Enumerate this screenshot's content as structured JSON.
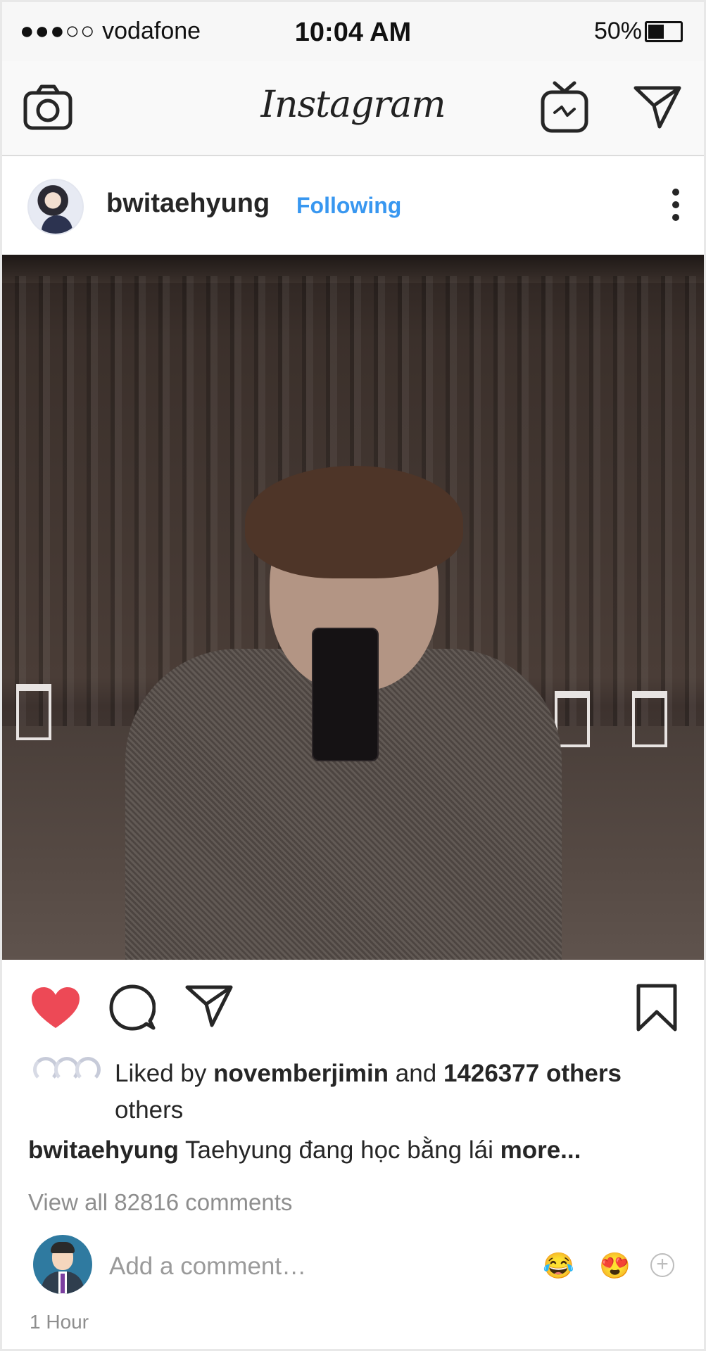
{
  "status_bar": {
    "signal_dots": "●●●○○",
    "carrier": "vodafone",
    "time": "10:04 AM",
    "battery_percent": "50%",
    "battery_level": 0.5
  },
  "nav": {
    "brand": "Instagram",
    "left_icon": "camera-icon",
    "igtv_icon": "igtv-icon",
    "direct_icon": "direct-message-icon"
  },
  "post": {
    "username": "bwitaehyung",
    "follow_status": "Following",
    "photo_alt": "post-photo",
    "liked": true,
    "likes": {
      "prefix": "Liked by",
      "liker": "novemberjimin",
      "and": "and",
      "count": "1426377",
      "others_bold": "others",
      "others": "others"
    },
    "caption": {
      "username": "bwitaehyung",
      "text": "Taehyung đang học bằng lái",
      "more": "more..."
    },
    "view_comments": "View all 82816 comments",
    "add_comment_placeholder": "Add a comment…",
    "quick_emojis": [
      "😂",
      "😍"
    ],
    "time_ago": "1 Hour"
  },
  "colors": {
    "link_blue": "#3897f0",
    "like_red": "#ed4956",
    "secondary_text": "#8e8e8e"
  }
}
